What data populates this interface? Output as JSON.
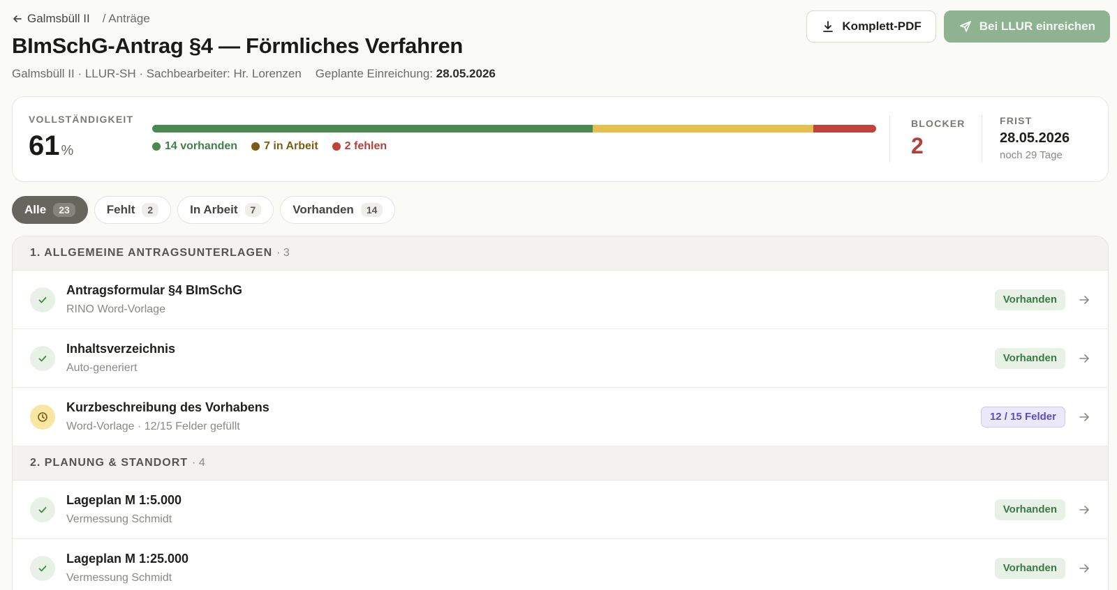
{
  "breadcrumb": {
    "back_label": "Galmsbüll II",
    "current": "/ Anträge"
  },
  "title": "BImSchG-Antrag §4 — Förmliches Verfahren",
  "subline": {
    "meta": "Galmsbüll II · LLUR-SH · Sachbearbeiter: Hr. Lorenzen",
    "planned_label": "Geplante Einreichung:",
    "planned_date": "28.05.2026"
  },
  "actions": {
    "pdf_label": "Komplett-PDF",
    "submit_label": "Bei LLUR einreichen"
  },
  "summary": {
    "completeness_label": "VOLLSTÄNDIGKEIT",
    "completeness_value": "61",
    "completeness_unit": "%",
    "progress": {
      "present": 14,
      "in_progress": 7,
      "missing": 2
    },
    "legend": {
      "present": "14 vorhanden",
      "in_progress": "7 in Arbeit",
      "missing": "2 fehlen"
    },
    "blocker_label": "BLOCKER",
    "blocker_value": "2",
    "deadline_label": "FRIST",
    "deadline_date": "28.05.2026",
    "deadline_remaining": "noch 29 Tage"
  },
  "colors": {
    "present": "#4a8a52",
    "in_progress": "#e5c04e",
    "missing": "#c1413b",
    "primary_button": "#8fb391"
  },
  "filters": [
    {
      "label": "Alle",
      "count": "23",
      "active": true
    },
    {
      "label": "Fehlt",
      "count": "2",
      "active": false
    },
    {
      "label": "In Arbeit",
      "count": "7",
      "active": false
    },
    {
      "label": "Vorhanden",
      "count": "14",
      "active": false
    }
  ],
  "groups": [
    {
      "title": "1. ALLGEMEINE ANTRAGSUNTERLAGEN",
      "count": "· 3",
      "items": [
        {
          "title": "Antragsformular §4 BImSchG",
          "sub": "RINO Word-Vorlage",
          "status": "ok",
          "badge": "Vorhanden",
          "icon": "check-icon"
        },
        {
          "title": "Inhaltsverzeichnis",
          "sub": "Auto-generiert",
          "status": "ok",
          "badge": "Vorhanden",
          "icon": "check-icon"
        },
        {
          "title": "Kurzbeschreibung des Vorhabens",
          "sub": "Word-Vorlage · 12/15 Felder gefüllt",
          "status": "wip",
          "badge": "12 / 15 Felder",
          "icon": "clock-icon"
        }
      ]
    },
    {
      "title": "2. PLANUNG & STANDORT",
      "count": "· 4",
      "items": [
        {
          "title": "Lageplan M 1:5.000",
          "sub": "Vermessung Schmidt",
          "status": "ok",
          "badge": "Vorhanden",
          "icon": "check-icon"
        },
        {
          "title": "Lageplan M 1:25.000",
          "sub": "Vermessung Schmidt",
          "status": "ok",
          "badge": "Vorhanden",
          "icon": "check-icon"
        }
      ]
    }
  ]
}
